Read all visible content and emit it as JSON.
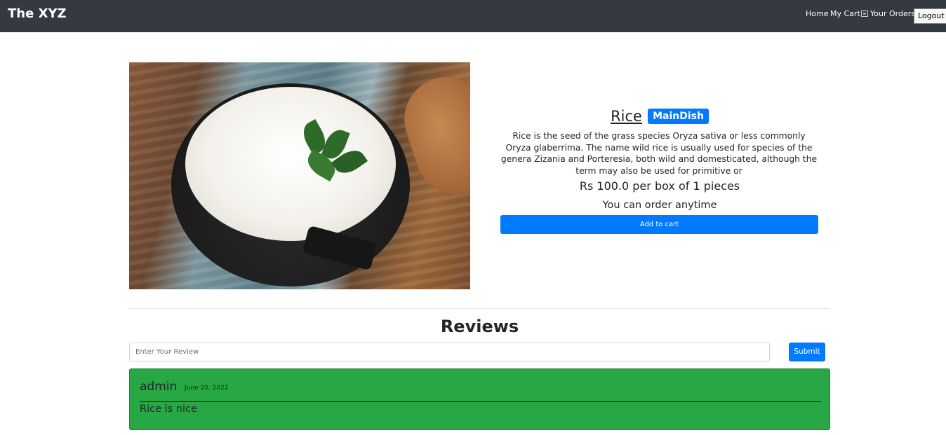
{
  "navbar": {
    "brand": "The XYZ",
    "links": [
      {
        "label": "Home"
      },
      {
        "label": "My Cart",
        "icon": "cart-icon"
      },
      {
        "label": "Your Orders"
      }
    ],
    "logout_label": "Logout",
    "background": "#343a40"
  },
  "product": {
    "image_alt": "Rice",
    "title": "Rice",
    "category": "MainDish",
    "description": "Rice is the seed of the grass species Oryza sativa or less commonly Oryza glaberrima. The name wild rice is usually used for species of the genera Zizania and Porteresia, both wild and domesticated, although the term may also be used for primitive or",
    "price_text": "Rs 100.0 per box of 1 pieces",
    "availability": "You can order anytime",
    "add_to_cart_label": "Add to cart"
  },
  "reviews": {
    "heading": "Reviews",
    "input_placeholder": "Enter Your Review",
    "input_value": "",
    "submit_label": "Submit",
    "items": [
      {
        "author": "admin",
        "date": "June 20, 2022",
        "text": "Rice is nice"
      }
    ]
  },
  "colors": {
    "primary": "#007bff",
    "review_card": "#28a745",
    "navbar": "#343a40"
  }
}
